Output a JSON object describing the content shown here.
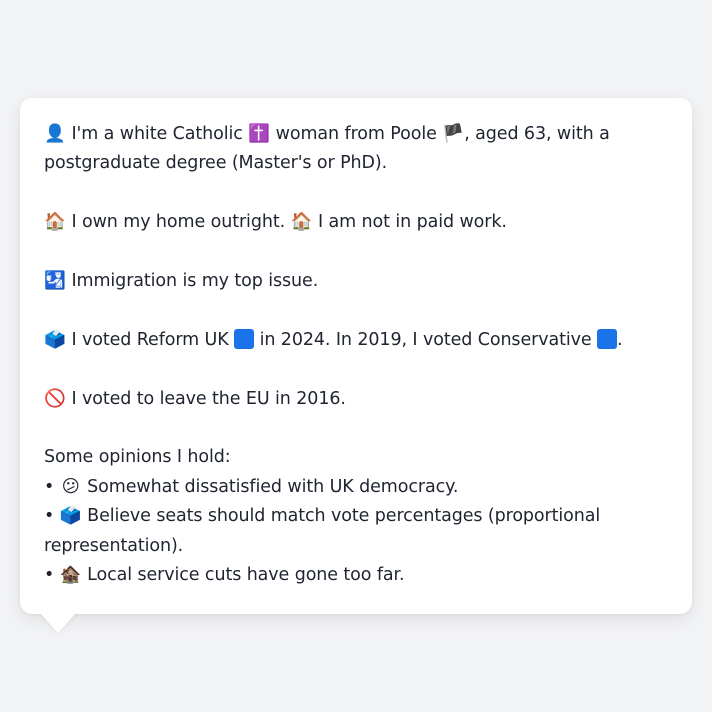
{
  "profile": {
    "identity_icon": "👤",
    "identity_text_1": " I'm a white Catholic ",
    "catholic_icon": "✝️",
    "identity_text_2": " woman from Poole ",
    "flag_icon": "🏴",
    "identity_text_3": ", aged 63, with a postgraduate degree (Master's or PhD).",
    "home_icon": "🏠",
    "home_text": " I own my home outright. ",
    "work_icon": "🏠",
    "work_text": " I am not in paid work.",
    "issue_icon": "🛂",
    "issue_text": " Immigration is my top issue.",
    "vote_icon": "🗳️",
    "vote_text_1": " I voted Reform UK ",
    "reform_color": "#1a73e8",
    "vote_text_2": " in 2024. In 2019, I voted Conservative ",
    "conservative_color": "#1a73e8",
    "vote_text_3": ".",
    "eu_icon": "🚫",
    "eu_text": " I voted to leave the EU in 2016.",
    "opinions_heading": "Some opinions I hold:",
    "opinions": [
      {
        "bullet": "•",
        "icon": "😕",
        "text": " Somewhat dissatisfied with UK democracy."
      },
      {
        "bullet": "•",
        "icon": "🗳️",
        "text": " Believe seats should match vote percentages (proportional representation)."
      },
      {
        "bullet": "•",
        "icon": "🏚️",
        "text": " Local service cuts have gone too far."
      }
    ]
  }
}
